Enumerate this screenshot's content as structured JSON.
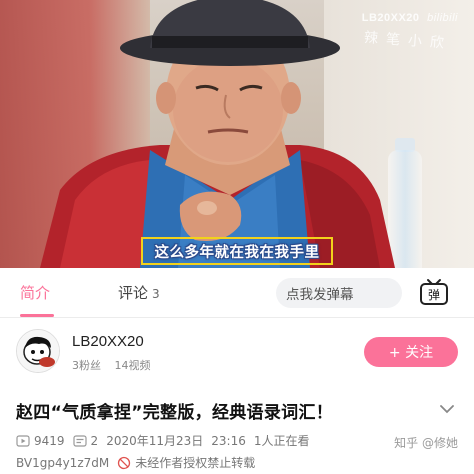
{
  "video": {
    "watermark": "LB20XX20",
    "platform_mark": "bilibili",
    "handwritten_mark": "辣笔小欣",
    "subtitle": "这么多年就在我在我手里"
  },
  "tabs": {
    "intro_label": "简介",
    "comment_label": "评论",
    "comment_count": "3",
    "danmaku_placeholder": "点我发弹幕",
    "danmaku_button_label": "弹"
  },
  "uploader": {
    "name": "LB20XX20",
    "fans": "3粉丝",
    "videos": "14视频",
    "follow_label": "+ 关注"
  },
  "title": "赵四“气质拿捏”完整版，经典语录词汇！",
  "meta": {
    "views": "9419",
    "danmaku": "2",
    "date": "2020年11月23日",
    "time": "23:16",
    "watching": "1人正在看",
    "bvid": "BV1gp4y1z7dM",
    "notice": "未经作者授权禁止转载"
  },
  "overlay": {
    "zhihu_watermark": "知乎 @修她"
  },
  "colors": {
    "accent": "#fb7299",
    "subtitle_box": "#f2d21b"
  }
}
